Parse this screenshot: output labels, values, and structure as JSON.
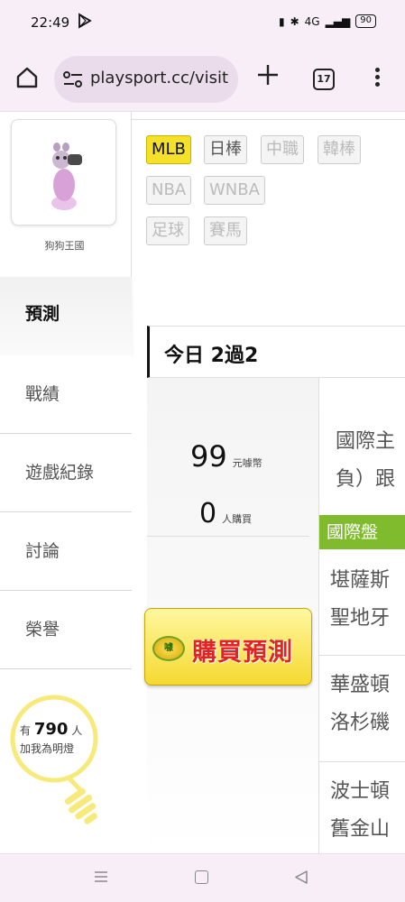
{
  "status_bar": {
    "time": "22:49",
    "network": "4G",
    "battery": "90"
  },
  "browser": {
    "url": "playsport.cc/visit",
    "tab_count": "17"
  },
  "profile": {
    "name": "狗狗王國"
  },
  "league_filters": [
    {
      "label": "MLB",
      "state": "active"
    },
    {
      "label": "日棒",
      "state": "normal"
    },
    {
      "label": "中職",
      "state": "disabled"
    },
    {
      "label": "韓棒",
      "state": "disabled"
    },
    {
      "label": "NBA",
      "state": "disabled"
    },
    {
      "label": "WNBA",
      "state": "disabled"
    },
    {
      "label": "足球",
      "state": "disabled"
    },
    {
      "label": "賽馬",
      "state": "disabled"
    }
  ],
  "sidebar": {
    "items": [
      {
        "label": "預測",
        "active": true
      },
      {
        "label": "戰績"
      },
      {
        "label": "遊戲紀錄"
      },
      {
        "label": "討論"
      },
      {
        "label": "榮譽"
      }
    ]
  },
  "fans": {
    "prefix": "有",
    "count": "790",
    "unit": "人",
    "caption": "加我為明燈"
  },
  "prediction": {
    "today_label": "今日 2過2",
    "price_value": "99",
    "price_unit": "元噱幣",
    "buyers_value": "0",
    "buyers_unit": "人購買",
    "buy_button": "購買預測",
    "coin_label": "噱",
    "game_title_line1": "國際主",
    "game_title_line2": "負）跟",
    "odds_header": "國際盤",
    "teams": [
      "堪薩斯",
      "聖地牙",
      "華盛頓",
      "洛杉磯",
      "波士頓",
      "舊金山"
    ]
  },
  "colors": {
    "active_chip": "#f5e02a",
    "odds_header": "#7fbb2d",
    "buy_text": "#e02424"
  }
}
